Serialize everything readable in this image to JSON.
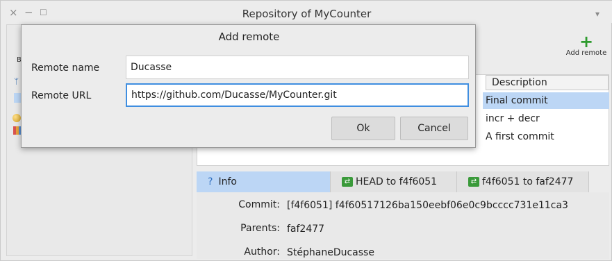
{
  "window": {
    "title": "Repository of MyCounter",
    "close_glyph": "×",
    "minimize_glyph": "−",
    "maximize_glyph": "☐",
    "menu_glyph": "▾"
  },
  "toolbar": {
    "add_remote_glyph": "+",
    "add_remote_label": "Add remote"
  },
  "sidebar": {
    "clipped_letter": "B"
  },
  "commits": {
    "header": "Description",
    "rows": [
      "Final commit",
      "incr + decr",
      "A first commit"
    ]
  },
  "tabs": [
    {
      "label": "Info",
      "icon": "?"
    },
    {
      "label": "HEAD to f4f6051",
      "icon": "diff-icon"
    },
    {
      "label": "f4f6051 to faf2477",
      "icon": "diff-icon"
    }
  ],
  "info": {
    "commit_label": "Commit:",
    "commit_value": "[f4f6051] f4f60517126ba150eebf06e0c9bcccc731e11ca3",
    "parents_label": "Parents:",
    "parents_value": "faf2477",
    "author_label": "Author:",
    "author_value": "StéphaneDucasse"
  },
  "dialog": {
    "title": "Add remote",
    "remote_name_label": "Remote name",
    "remote_name_value": "Ducasse",
    "remote_url_label": "Remote URL",
    "remote_url_value": "https://github.com/Ducasse/MyCounter.git",
    "ok_label": "Ok",
    "cancel_label": "Cancel"
  },
  "colors": {
    "selection": "#bcd6f5",
    "focus_border": "#3f8ee0",
    "add_icon": "#2e9b2e"
  }
}
